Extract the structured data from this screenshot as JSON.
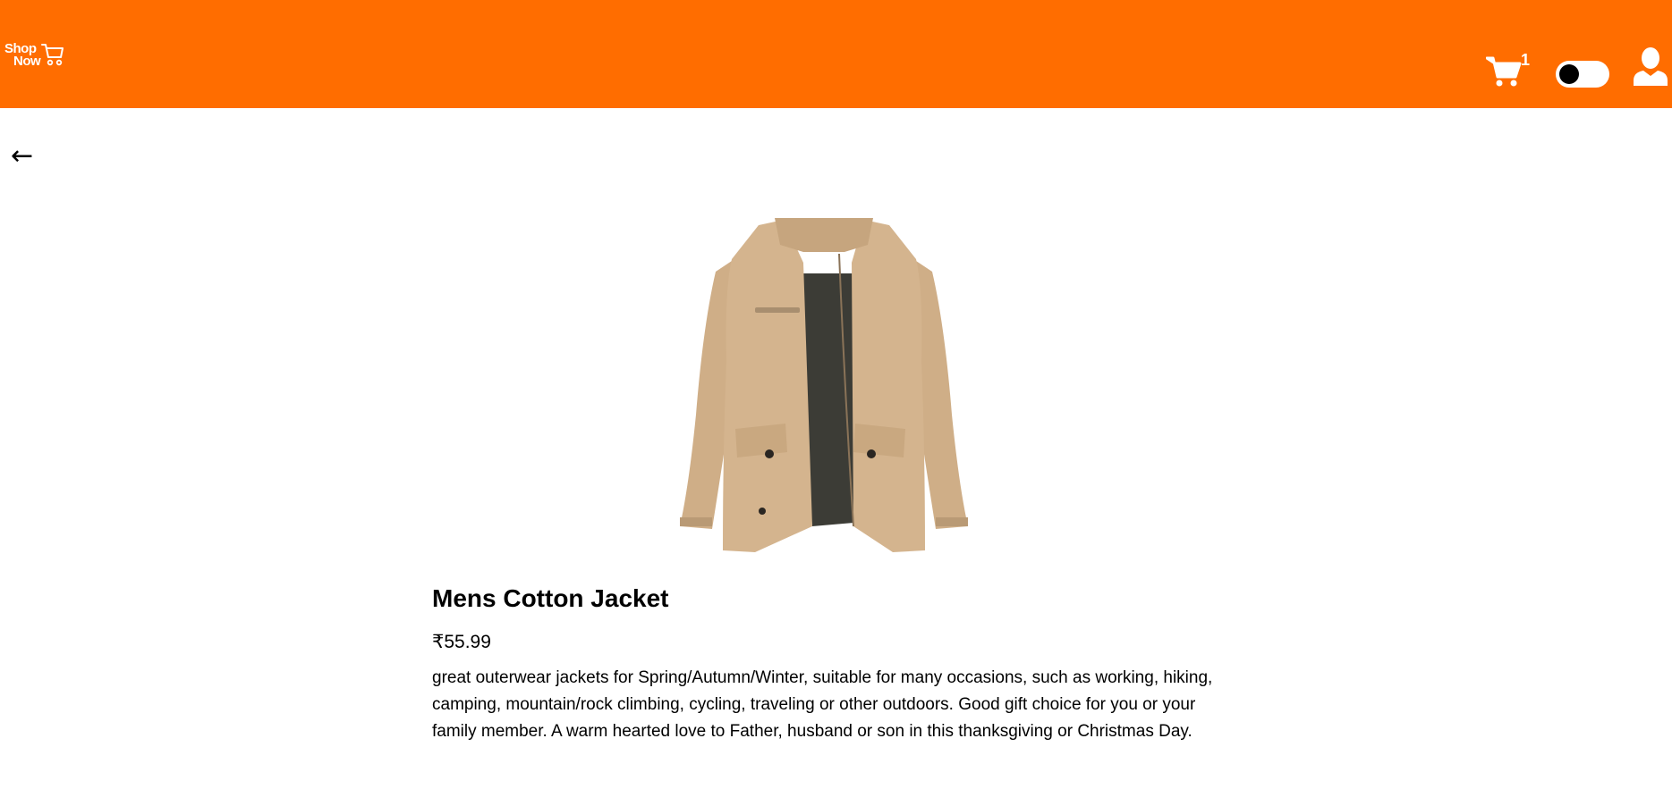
{
  "navbar": {
    "logo": {
      "line1": "Shop",
      "line2": "Now",
      "icon": "shopping-cart-icon"
    },
    "cart": {
      "icon": "shopping-cart-icon",
      "count": "1"
    },
    "theme_toggle": {
      "icon": "toggle-switch",
      "state": "off"
    },
    "profile": {
      "icon": "user-icon"
    }
  },
  "back": {
    "label": "←",
    "icon": "arrow-left-icon"
  },
  "product": {
    "image_alt": "Mens Cotton Jacket",
    "title": "Mens Cotton Jacket",
    "price": "₹55.99",
    "description": "great outerwear jackets for Spring/Autumn/Winter, suitable for many occasions, such as working, hiking, camping, mountain/rock climbing, cycling, traveling or other outdoors. Good gift choice for you or your family member. A warm hearted love to Father, husband or son in this thanksgiving or Christmas Day."
  },
  "colors": {
    "navbar_bg": "#ff6d00",
    "jacket": "#d4b48e",
    "lining": "#3c3c36"
  }
}
